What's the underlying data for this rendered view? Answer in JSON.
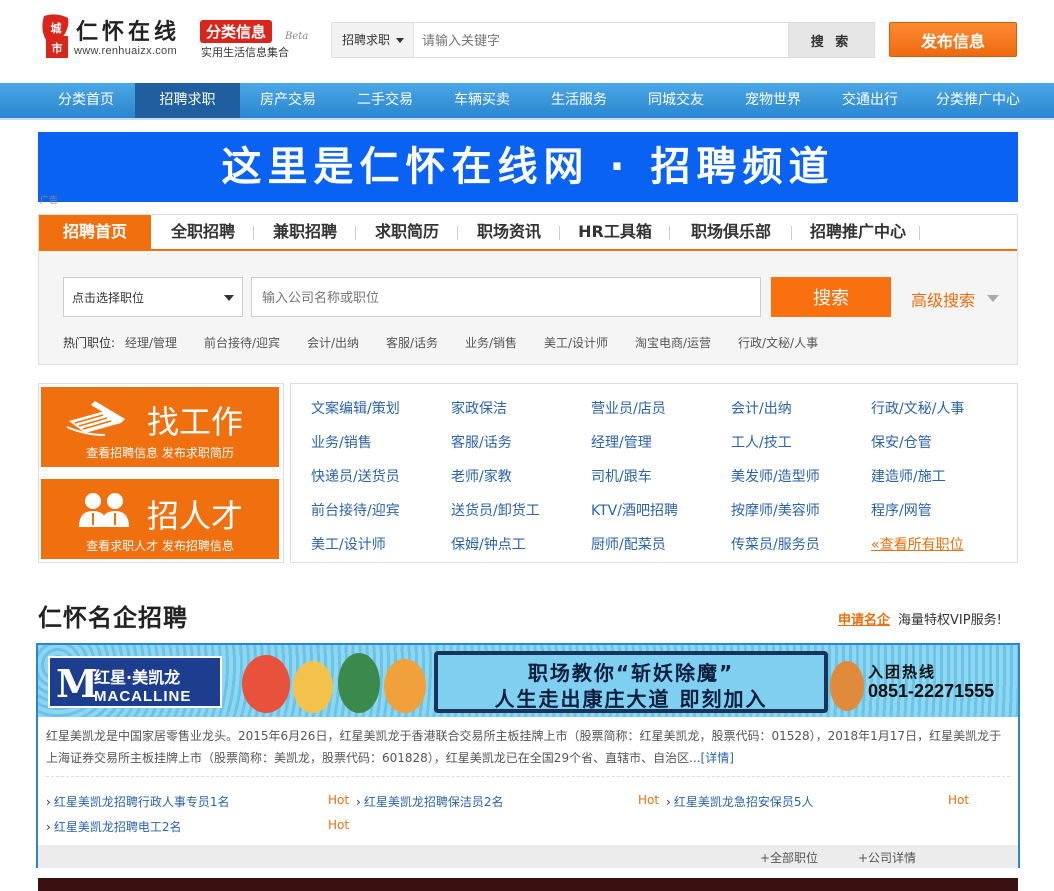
{
  "header": {
    "logo_text": "仁怀在线",
    "logo_mark": "城市",
    "logo_url": "www.renhuaizx.com",
    "cat_badge": "分类信息",
    "beta": "Beta",
    "cat_sub": "实用生活信息集合",
    "search": {
      "category": "招聘求职",
      "placeholder": "请输入关键字",
      "button": "搜 索"
    },
    "publish": "发布信息"
  },
  "mainnav": [
    "分类首页",
    "招聘求职",
    "房产交易",
    "二手交易",
    "车辆买卖",
    "生活服务",
    "同城交友",
    "宠物世界",
    "交通出行",
    "分类推广中心"
  ],
  "mainnav_active": "招聘求职",
  "banner": {
    "text": "这里是仁怀在线网 · 招聘频道",
    "ad_tag": "广告"
  },
  "recruit": {
    "tabs": [
      "招聘首页",
      "全职招聘",
      "兼职招聘",
      "求职简历",
      "职场资讯",
      "HR工具箱",
      "职场俱乐部",
      "招聘推广中心"
    ],
    "job_select": "点击选择职位",
    "input_placeholder": "输入公司名称或职位",
    "search_button": "搜索",
    "advanced": "高级搜索",
    "hot_label": "热门职位:",
    "hot_items": [
      "经理/管理",
      "前台接待/迎宾",
      "会计/出纳",
      "客服/话务",
      "业务/销售",
      "美工/设计师",
      "淘宝电商/运营",
      "行政/文秘/人事"
    ]
  },
  "cta": {
    "find_job": {
      "title": "找工作",
      "links": "查看招聘信息  发布求职简历",
      "icon": "pen-paper-icon"
    },
    "find_talent": {
      "title": "招人才",
      "links": "查看求职人才  发布招聘信息",
      "icon": "people-icon"
    }
  },
  "jobs": [
    [
      "文案编辑/策划",
      "家政保洁",
      "营业员/店员",
      "会计/出纳",
      "行政/文秘/人事"
    ],
    [
      "业务/销售",
      "客服/话务",
      "经理/管理",
      "工人/技工",
      "保安/仓管"
    ],
    [
      "快递员/送货员",
      "老师/家教",
      "司机/跟车",
      "美发师/造型师",
      "建造师/施工"
    ],
    [
      "前台接待/迎宾",
      "送货员/卸货工",
      "KTV/酒吧招聘",
      "按摩师/美容师",
      "程序/网管"
    ],
    [
      "美工/设计师",
      "保姆/钟点工",
      "厨师/配菜员",
      "传菜员/服务员",
      "«查看所有职位"
    ]
  ],
  "famous": {
    "title": "仁怀名企招聘",
    "apply": "申请名企",
    "vip": "海量特权VIP服务!",
    "company": {
      "logo_cn": "红星·美凯龙",
      "logo_en": "MACALLINE",
      "logo_m": "M",
      "slogan1": "职场教你“斩妖除魔”",
      "slogan2": "人生走出康庄大道 即刻加入",
      "hotline_label": "入团热线",
      "hotline": "0851-22271555",
      "desc": "红星美凯龙是中国家居零售业龙头。2015年6月26日，红星美凯龙于香港联合交易所主板挂牌上市（股票简称：红星美凯龙，股票代码：01528），2018年1月17日，红星美凯龙于上海证券交易所主板挂牌上市（股票简称：美凯龙，股票代码：601828），红星美凯龙已在全国29个省、直辖市、自治区...",
      "detail": "[详情]",
      "positions": [
        {
          "title": "红星美凯龙招聘行政人事专员1名",
          "tag": "Hot"
        },
        {
          "title": "红星美凯龙招聘保洁员2名",
          "tag": "Hot"
        },
        {
          "title": "红星美凯龙急招安保员5人",
          "tag": "Hot"
        },
        {
          "title": "红星美凯龙招聘电工2名",
          "tag": "Hot"
        }
      ],
      "all_positions": "+全部职位",
      "company_detail": "+公司详情"
    }
  },
  "colors": {
    "orange": "#f0700f",
    "nav_blue": "#2a86cf",
    "banner_blue": "#0a62f2",
    "link_blue": "#2a63a8"
  }
}
